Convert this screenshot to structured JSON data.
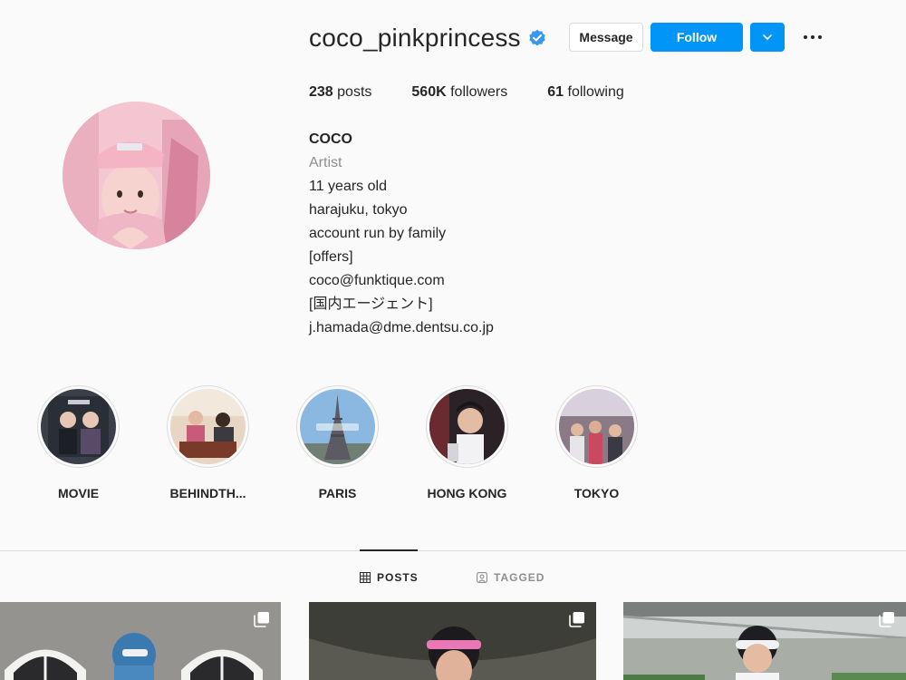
{
  "profile": {
    "username": "coco_pinkprincess",
    "verified": true,
    "buttons": {
      "message": "Message",
      "follow": "Follow"
    },
    "stats": {
      "posts_count": "238",
      "posts_label": "posts",
      "followers_count": "560K",
      "followers_label": "followers",
      "following_count": "61",
      "following_label": "following"
    },
    "bio": {
      "name": "COCO",
      "category": "Artist",
      "lines": [
        "11 years old",
        "harajuku, tokyo",
        "account run by family",
        "[offers]",
        "coco@funktique.com",
        "[国内エージェント]",
        "j.hamada@dme.dentsu.co.jp"
      ]
    }
  },
  "highlights": [
    {
      "label": "MOVIE"
    },
    {
      "label": "BEHINDTH..."
    },
    {
      "label": "PARIS"
    },
    {
      "label": "HONG KONG"
    },
    {
      "label": "TOKYO"
    }
  ],
  "tabs": [
    {
      "label": "POSTS",
      "active": true
    },
    {
      "label": "TAGGED",
      "active": false
    }
  ],
  "colors": {
    "accent": "#0095f6",
    "background": "#fafafa",
    "text": "#262626",
    "muted": "#8e8e8e",
    "border": "#dbdbdb"
  },
  "icons": [
    "verified-badge-icon",
    "chevron-down-icon",
    "more-options-icon",
    "grid-icon",
    "tagged-icon",
    "multiple-photos-icon"
  ]
}
